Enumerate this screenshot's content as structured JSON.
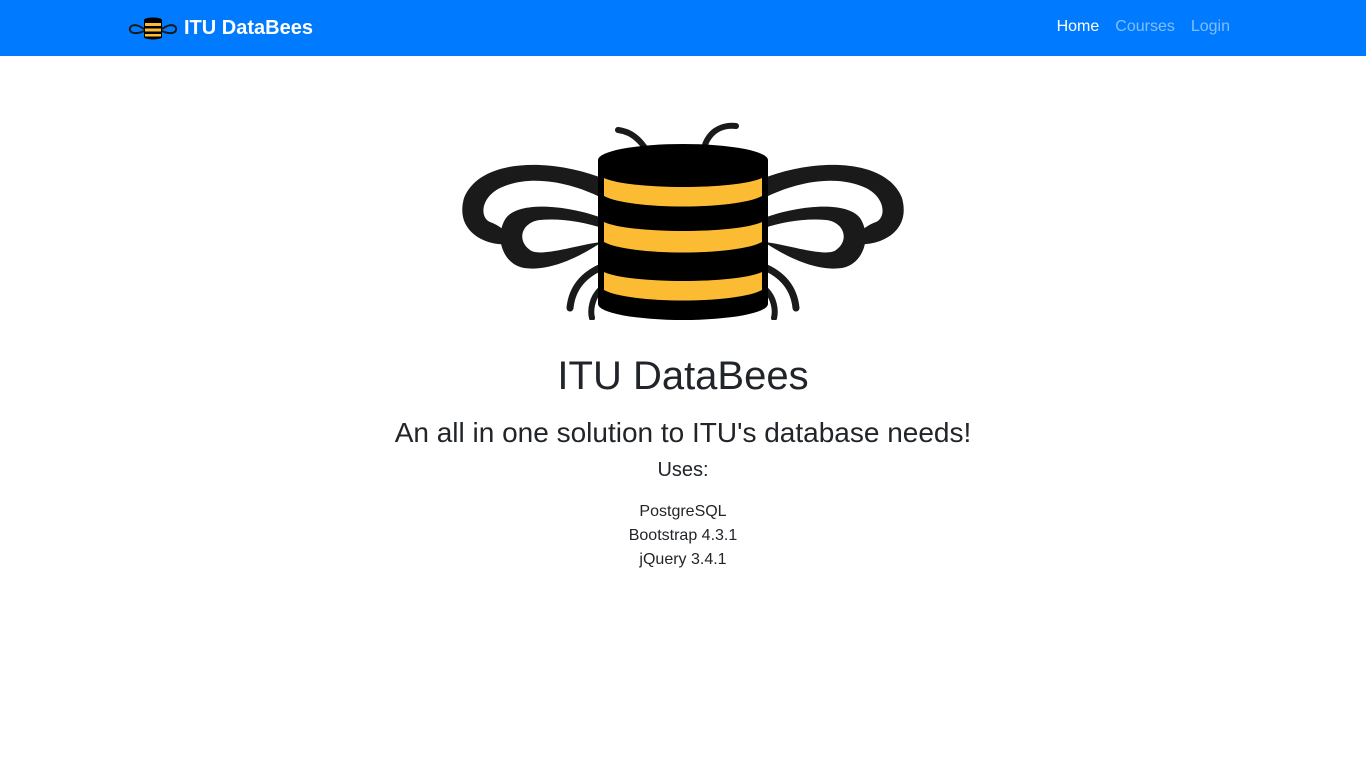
{
  "navbar": {
    "brand_text": "ITU DataBees",
    "links": [
      {
        "label": "Home",
        "active": true
      },
      {
        "label": "Courses",
        "active": false
      },
      {
        "label": "Login",
        "active": false
      }
    ],
    "background_color": "#007bff"
  },
  "hero": {
    "logo_icon": "database-bee-logo-icon",
    "title": "ITU DataBees",
    "subtitle": "An all in one solution to ITU's database needs!",
    "uses_heading": "Uses:",
    "uses": [
      "PostgreSQL",
      "Bootstrap 4.3.1",
      "jQuery 3.4.1"
    ]
  },
  "colors": {
    "accent": "#007bff",
    "bee_yellow": "#fbbc34",
    "bee_black": "#000000"
  }
}
